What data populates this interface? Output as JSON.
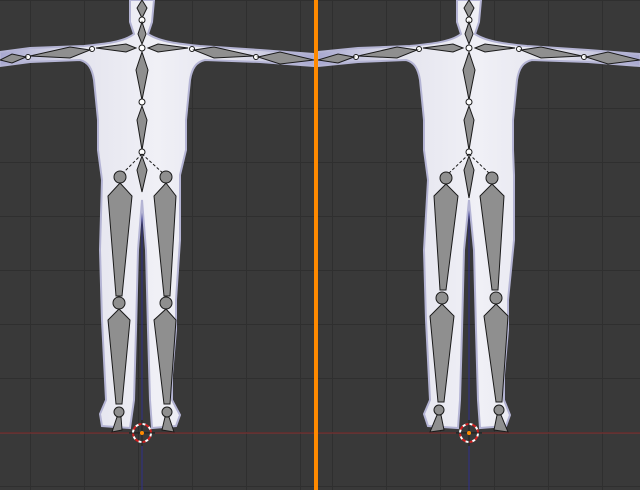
{
  "colors": {
    "background": "#393939",
    "grid": "#2f2f2f",
    "axis_x": "#8a3030",
    "axis_z": "#30308a",
    "active_divider": "#ff8a00",
    "mesh_fill": "#e2e2ec",
    "mesh_rim": "#b9b9d8",
    "bone_fill": "#8f8f8f",
    "bone_outline": "#1a1a1a",
    "cursor_red": "#d02020",
    "cursor_white": "#ffffff"
  },
  "viewports": [
    {
      "name": "viewport-left",
      "active": false
    },
    {
      "name": "viewport-right",
      "active": true
    }
  ]
}
